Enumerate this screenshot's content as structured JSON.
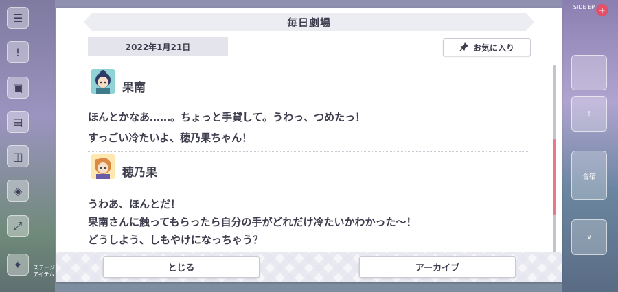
{
  "dialog": {
    "title": "毎日劇場",
    "date": "2022年1月21日",
    "favorite_label": "お気に入り",
    "entries": [
      {
        "speaker": "果南",
        "avatar_color": "#5fa7b8",
        "lines": [
          "ほんとかなあ……。ちょっと手貸して。うわっ、つめたっ！",
          "すっごい冷たいよ、穂乃果ちゃん！"
        ]
      },
      {
        "speaker": "穂乃果",
        "avatar_color": "#f0b76a",
        "lines": [
          "うわあ、ほんとだ！",
          "果南さんに触ってもらったら自分の手がどれだけ冷たいかわかった～！",
          "どうしよう、しもやけになっちゃう？"
        ]
      }
    ],
    "close_label": "とじる",
    "archive_label": "アーカイブ"
  },
  "background": {
    "left_label_1": "ステージ",
    "left_label_2": "アイテム",
    "right_tile_label": "合宿",
    "right_header": "SIDE EP"
  },
  "colors": {
    "scroll_thumb": "#e6798a",
    "text": "#3d3d4d"
  }
}
